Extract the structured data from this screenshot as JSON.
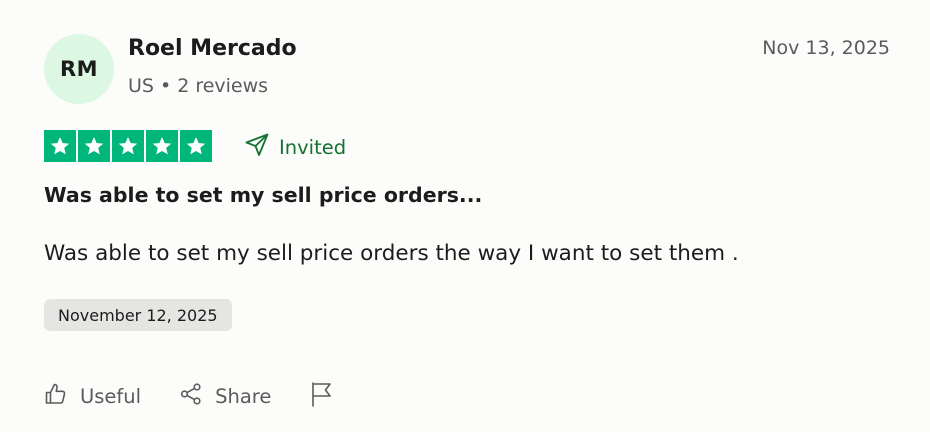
{
  "review": {
    "avatar_initials": "RM",
    "author_name": "Roel Mercado",
    "country": "US",
    "separator": "•",
    "review_count": "2 reviews",
    "posted_date": "Nov 13, 2025",
    "rating": 5,
    "rating_max": 5,
    "invited_label": "Invited",
    "title": "Was able to set my sell price orders...",
    "body": "Was able to set my sell price orders the way I want to set them .",
    "experience_date": "November 12, 2025"
  },
  "actions": {
    "useful_label": "Useful",
    "share_label": "Share"
  },
  "colors": {
    "star_green": "#00b67a",
    "invited_green": "#14722f",
    "avatar_bg": "#dcf8e3",
    "date_chip_bg": "#e5e5e3"
  },
  "icons": [
    "star-icon",
    "send-icon",
    "thumbs-up-icon",
    "share-icon",
    "flag-icon"
  ]
}
